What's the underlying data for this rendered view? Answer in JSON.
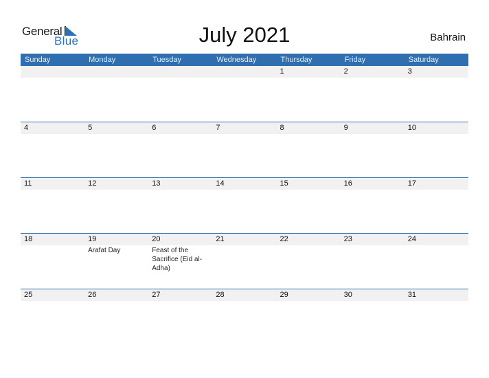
{
  "logo": {
    "line1": "General",
    "line2": "Blue",
    "accent_color": "#2b72b7"
  },
  "title": "July 2021",
  "country": "Bahrain",
  "colors": {
    "header_bg": "#2f6fb0",
    "date_strip_bg": "#f1f1f1"
  },
  "weekdays": [
    "Sunday",
    "Monday",
    "Tuesday",
    "Wednesday",
    "Thursday",
    "Friday",
    "Saturday"
  ],
  "weeks": [
    [
      {
        "day": ""
      },
      {
        "day": ""
      },
      {
        "day": ""
      },
      {
        "day": ""
      },
      {
        "day": "1"
      },
      {
        "day": "2"
      },
      {
        "day": "3"
      }
    ],
    [
      {
        "day": "4"
      },
      {
        "day": "5"
      },
      {
        "day": "6"
      },
      {
        "day": "7"
      },
      {
        "day": "8"
      },
      {
        "day": "9"
      },
      {
        "day": "10"
      }
    ],
    [
      {
        "day": "11"
      },
      {
        "day": "12"
      },
      {
        "day": "13"
      },
      {
        "day": "14"
      },
      {
        "day": "15"
      },
      {
        "day": "16"
      },
      {
        "day": "17"
      }
    ],
    [
      {
        "day": "18"
      },
      {
        "day": "19",
        "event": "Arafat Day"
      },
      {
        "day": "20",
        "event": "Feast of the Sacrifice (Eid al-Adha)"
      },
      {
        "day": "21"
      },
      {
        "day": "22"
      },
      {
        "day": "23"
      },
      {
        "day": "24"
      }
    ],
    [
      {
        "day": "25"
      },
      {
        "day": "26"
      },
      {
        "day": "27"
      },
      {
        "day": "28"
      },
      {
        "day": "29"
      },
      {
        "day": "30"
      },
      {
        "day": "31"
      }
    ]
  ]
}
